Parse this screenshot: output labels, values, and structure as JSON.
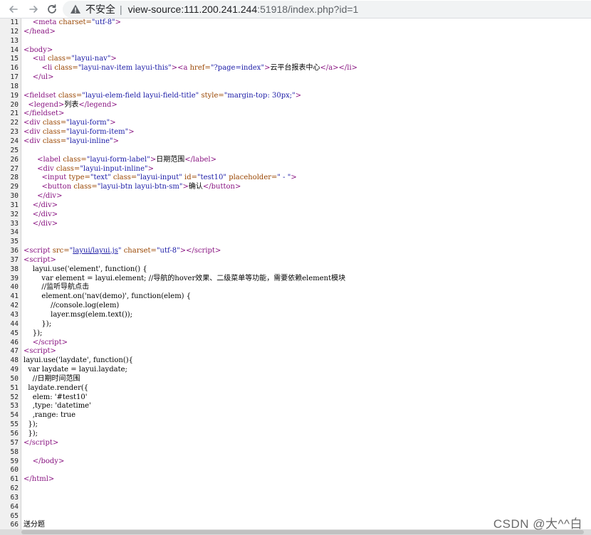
{
  "toolbar": {
    "security_label": "不安全",
    "separator": "|",
    "url_host": "view-source:111.200.241.244",
    "url_rest": ":51918/index.php?id=1"
  },
  "source_lines": [
    {
      "n": "11",
      "html": "    <span class=\"tag\">&lt;meta</span> <span class=\"attr\">charset=</span><span class=\"val\">\"utf-8\"</span><span class=\"tag\">&gt;</span>"
    },
    {
      "n": "12",
      "html": "<span class=\"tag\">&lt;/head&gt;</span>"
    },
    {
      "n": "13",
      "html": ""
    },
    {
      "n": "14",
      "html": "<span class=\"tag\">&lt;body&gt;</span>"
    },
    {
      "n": "15",
      "html": "    <span class=\"tag\">&lt;ul</span> <span class=\"attr\">class=</span><span class=\"val\">\"layui-nav\"</span><span class=\"tag\">&gt;</span>"
    },
    {
      "n": "16",
      "html": "        <span class=\"tag\">&lt;li</span> <span class=\"attr\">class=</span><span class=\"val\">\"layui-nav-item layui-this\"</span><span class=\"tag\">&gt;&lt;a</span> <span class=\"attr\">href=</span><span class=\"val\">\"?page=index\"</span><span class=\"tag\">&gt;</span><span class=\"txt\">云平台报表中心</span><span class=\"tag\">&lt;/a&gt;&lt;/li&gt;</span>"
    },
    {
      "n": "17",
      "html": "    <span class=\"tag\">&lt;/ul&gt;</span>"
    },
    {
      "n": "18",
      "html": ""
    },
    {
      "n": "19",
      "html": "<span class=\"tag\">&lt;fieldset</span> <span class=\"attr\">class=</span><span class=\"val\">\"layui-elem-field layui-field-title\"</span> <span class=\"attr\">style=</span><span class=\"val\">\"margin-top: 30px;\"</span><span class=\"tag\">&gt;</span>"
    },
    {
      "n": "20",
      "html": "  <span class=\"tag\">&lt;legend&gt;</span><span class=\"txt\">列表</span><span class=\"tag\">&lt;/legend&gt;</span>"
    },
    {
      "n": "21",
      "html": "<span class=\"tag\">&lt;/fieldset&gt;</span>"
    },
    {
      "n": "22",
      "html": "<span class=\"tag\">&lt;div</span> <span class=\"attr\">class=</span><span class=\"val\">\"layui-form\"</span><span class=\"tag\">&gt;</span>"
    },
    {
      "n": "23",
      "html": "<span class=\"tag\">&lt;div</span> <span class=\"attr\">class=</span><span class=\"val\">\"layui-form-item\"</span><span class=\"tag\">&gt;</span>"
    },
    {
      "n": "24",
      "html": "<span class=\"tag\">&lt;div</span> <span class=\"attr\">class=</span><span class=\"val\">\"layui-inline\"</span><span class=\"tag\">&gt;</span>"
    },
    {
      "n": "25",
      "html": ""
    },
    {
      "n": "26",
      "html": "      <span class=\"tag\">&lt;label</span> <span class=\"attr\">class=</span><span class=\"val\">\"layui-form-label\"</span><span class=\"tag\">&gt;</span><span class=\"txt\">日期范围</span><span class=\"tag\">&lt;/label&gt;</span>"
    },
    {
      "n": "27",
      "html": "      <span class=\"tag\">&lt;div</span> <span class=\"attr\">class=</span><span class=\"val\">\"layui-input-inline\"</span><span class=\"tag\">&gt;</span>"
    },
    {
      "n": "28",
      "html": "        <span class=\"tag\">&lt;input</span> <span class=\"attr\">type=</span><span class=\"val\">\"text\"</span> <span class=\"attr\">class=</span><span class=\"val\">\"layui-input\"</span> <span class=\"attr\">id=</span><span class=\"val\">\"test10\"</span> <span class=\"attr\">placeholder=</span><span class=\"val\">\" - \"</span><span class=\"tag\">&gt;</span>"
    },
    {
      "n": "29",
      "html": "        <span class=\"tag\">&lt;button</span> <span class=\"attr\">class=</span><span class=\"val\">\"layui-btn layui-btn-sm\"</span><span class=\"tag\">&gt;</span><span class=\"txt\">确认</span><span class=\"tag\">&lt;/button&gt;</span>"
    },
    {
      "n": "30",
      "html": "      <span class=\"tag\">&lt;/div&gt;</span>"
    },
    {
      "n": "31",
      "html": "    <span class=\"tag\">&lt;/div&gt;</span>"
    },
    {
      "n": "32",
      "html": "    <span class=\"tag\">&lt;/div&gt;</span>"
    },
    {
      "n": "33",
      "html": "    <span class=\"tag\">&lt;/div&gt;</span>"
    },
    {
      "n": "34",
      "html": ""
    },
    {
      "n": "35",
      "html": ""
    },
    {
      "n": "36",
      "html": "<span class=\"tag\">&lt;script</span> <span class=\"attr\">src=</span><span class=\"val\">\"</span><span class=\"lnk\">layui/layui.js</span><span class=\"val\">\"</span> <span class=\"attr\">charset=</span><span class=\"val\">\"utf-8\"</span><span class=\"tag\">&gt;&lt;/script&gt;</span>"
    },
    {
      "n": "37",
      "html": "<span class=\"tag\">&lt;script&gt;</span>"
    },
    {
      "n": "38",
      "html": "    layui.use('element', function() {"
    },
    {
      "n": "39",
      "html": "        var element = layui.element; //导航的hover效果、二级菜单等功能，需要依赖element模块"
    },
    {
      "n": "40",
      "html": "        //监听导航点击"
    },
    {
      "n": "41",
      "html": "        element.on('nav(demo)', function(elem) {"
    },
    {
      "n": "42",
      "html": "            //console.log(elem)"
    },
    {
      "n": "43",
      "html": "            layer.msg(elem.text());"
    },
    {
      "n": "44",
      "html": "        });"
    },
    {
      "n": "45",
      "html": "    });"
    },
    {
      "n": "46",
      "html": "    <span class=\"tag\">&lt;/script&gt;</span>"
    },
    {
      "n": "47",
      "html": "<span class=\"tag\">&lt;script&gt;</span>"
    },
    {
      "n": "48",
      "html": "layui.use('laydate', function(){"
    },
    {
      "n": "49",
      "html": "  var laydate = layui.laydate;"
    },
    {
      "n": "50",
      "html": "    //日期时间范围"
    },
    {
      "n": "51",
      "html": "  laydate.render({"
    },
    {
      "n": "52",
      "html": "    elem: '#test10'"
    },
    {
      "n": "53",
      "html": "    ,type: 'datetime'"
    },
    {
      "n": "54",
      "html": "    ,range: true"
    },
    {
      "n": "55",
      "html": "  });"
    },
    {
      "n": "56",
      "html": "  });"
    },
    {
      "n": "57",
      "html": "<span class=\"tag\">&lt;/script&gt;</span>"
    },
    {
      "n": "58",
      "html": ""
    },
    {
      "n": "59",
      "html": "    <span class=\"tag\">&lt;/body&gt;</span>"
    },
    {
      "n": "60",
      "html": ""
    },
    {
      "n": "61",
      "html": "<span class=\"tag\">&lt;/html&gt;</span>"
    },
    {
      "n": "62",
      "html": ""
    },
    {
      "n": "63",
      "html": ""
    },
    {
      "n": "64",
      "html": ""
    },
    {
      "n": "65",
      "html": ""
    },
    {
      "n": "66",
      "html": "<span class=\"txt\">送分题</span>"
    }
  ],
  "watermark": "CSDN @大^^白",
  "colors": {
    "tag": "#881280",
    "attr": "#994500",
    "value": "#1a1aa6"
  }
}
